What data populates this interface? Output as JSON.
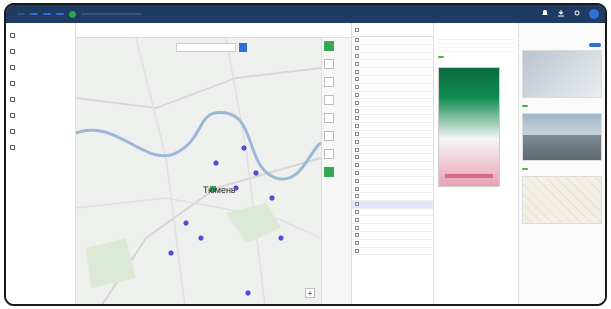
{
  "app": {
    "title": "",
    "period_label": "",
    "filters": [
      "",
      "",
      ""
    ],
    "search_placeholder": ""
  },
  "sidebar": {
    "items": [
      {
        "label": "",
        "icon": "list-icon"
      },
      {
        "label": "",
        "icon": "map-icon"
      },
      {
        "label": "",
        "icon": "folder-icon"
      },
      {
        "label": "",
        "icon": "chart-icon"
      },
      {
        "label": "",
        "icon": "document-icon"
      },
      {
        "label": "",
        "icon": "layers-icon"
      },
      {
        "label": "",
        "icon": "settings-icon"
      },
      {
        "label": "",
        "icon": "user-icon"
      }
    ]
  },
  "map": {
    "found_label": "",
    "found_count": "",
    "selected_label": "",
    "tabs": [
      "",
      "",
      "",
      "",
      "",
      ""
    ],
    "search_placeholder": "",
    "search_button": "",
    "mode_label": "",
    "city_label": "Тюмень",
    "district_labels": [
      "",
      "",
      "",
      ""
    ],
    "tools": [
      "pointer-icon",
      "ruler-icon",
      "polygon-icon",
      "layers-icon",
      "print-icon",
      "filter-icon",
      "pin-icon",
      "edit-icon"
    ]
  },
  "list": {
    "header_num": "",
    "header_addr": "",
    "rows": [
      {
        "n": "",
        "a": ""
      },
      {
        "n": "",
        "a": ""
      },
      {
        "n": "",
        "a": ""
      },
      {
        "n": "",
        "a": ""
      },
      {
        "n": "",
        "a": ""
      },
      {
        "n": "",
        "a": ""
      },
      {
        "n": "",
        "a": ""
      },
      {
        "n": "",
        "a": ""
      },
      {
        "n": "",
        "a": ""
      },
      {
        "n": "",
        "a": ""
      },
      {
        "n": "",
        "a": ""
      },
      {
        "n": "",
        "a": ""
      },
      {
        "n": "",
        "a": ""
      },
      {
        "n": "",
        "a": ""
      },
      {
        "n": "",
        "a": ""
      },
      {
        "n": "",
        "a": ""
      },
      {
        "n": "",
        "a": ""
      },
      {
        "n": "",
        "a": ""
      },
      {
        "n": "",
        "a": ""
      },
      {
        "n": "",
        "a": ""
      },
      {
        "n": "",
        "a": ""
      },
      {
        "n": "",
        "a": ""
      },
      {
        "n": "",
        "a": ""
      },
      {
        "n": "",
        "a": ""
      },
      {
        "n": "",
        "a": ""
      },
      {
        "n": "",
        "a": ""
      },
      {
        "n": "",
        "a": ""
      },
      {
        "n": "",
        "a": ""
      }
    ],
    "selected_index": 21
  },
  "details": {
    "period_label": "",
    "period_value": "",
    "sides_label": "",
    "sides_value": "",
    "section_title": "",
    "kv": [
      {
        "k": "",
        "v": ""
      },
      {
        "k": "",
        "v": ""
      },
      {
        "k": "",
        "v": ""
      },
      {
        "k": "",
        "v": ""
      }
    ],
    "tag": "",
    "brand": "",
    "poster_caption": ""
  },
  "photos": {
    "action_button": "",
    "view_label": "",
    "table_label": "",
    "captions": [
      "",
      "",
      ""
    ],
    "tags": [
      "",
      ""
    ]
  },
  "colors": {
    "topbar": "#1f3b63",
    "accent": "#2e6fd8",
    "marker": "#5a47d8",
    "green": "#34a853"
  }
}
